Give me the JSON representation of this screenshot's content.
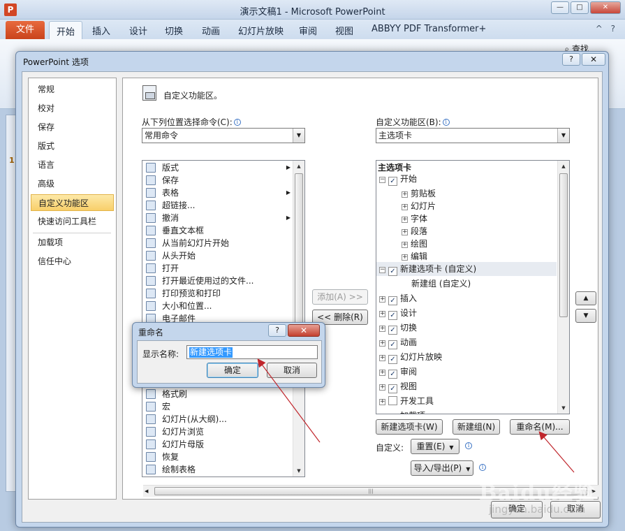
{
  "app": {
    "icon_letter": "P",
    "title": "演示文稿1 - Microsoft PowerPoint",
    "file_tab": "文件",
    "tabs": [
      "开始",
      "插入",
      "设计",
      "切换",
      "动画",
      "幻灯片放映",
      "审阅",
      "视图",
      "ABBYY PDF Transformer+"
    ],
    "find_label": "查找",
    "slide_number": "1"
  },
  "options_dialog": {
    "title": "PowerPoint 选项",
    "help": "?",
    "close": "✕",
    "nav": [
      "常规",
      "校对",
      "保存",
      "版式",
      "语言",
      "高级",
      "自定义功能区",
      "快速访问工具栏",
      "加载项",
      "信任中心"
    ],
    "active_nav": "自定义功能区",
    "header": "自定义功能区。",
    "choose_from_label": "从下列位置选择命令(C):",
    "choose_from_value": "常用命令",
    "customize_label": "自定义功能区(B):",
    "customize_value": "主选项卡",
    "commands": [
      {
        "label": "版式",
        "submenu": true
      },
      {
        "label": "保存",
        "submenu": false
      },
      {
        "label": "表格",
        "submenu": true
      },
      {
        "label": "超链接...",
        "submenu": false
      },
      {
        "label": "撤消",
        "submenu": true
      },
      {
        "label": "垂直文本框",
        "submenu": false
      },
      {
        "label": "从当前幻灯片开始",
        "submenu": false
      },
      {
        "label": "从头开始",
        "submenu": false
      },
      {
        "label": "打开",
        "submenu": false
      },
      {
        "label": "打开最近使用过的文件...",
        "submenu": false
      },
      {
        "label": "打印预览和打印",
        "submenu": false
      },
      {
        "label": "大小和位置...",
        "submenu": false
      },
      {
        "label": "电子邮件",
        "submenu": false
      }
    ],
    "commands_lower": [
      "格式刷",
      "宏",
      "幻灯片(从大纲)...",
      "幻灯片浏览",
      "幻灯片母版",
      "恢复",
      "绘制表格"
    ],
    "add_button": "添加(A) >>",
    "remove_button": "<< 删除(R)",
    "tree_header": "主选项卡",
    "tree": [
      {
        "label": "开始",
        "level": 0,
        "checkbox": true,
        "checked": true,
        "expander": "⊟"
      },
      {
        "label": "剪贴板",
        "level": 1,
        "expander": "+"
      },
      {
        "label": "幻灯片",
        "level": 1,
        "expander": "+"
      },
      {
        "label": "字体",
        "level": 1,
        "expander": "+"
      },
      {
        "label": "段落",
        "level": 1,
        "expander": "+"
      },
      {
        "label": "绘图",
        "level": 1,
        "expander": "+"
      },
      {
        "label": "编辑",
        "level": 1,
        "expander": "+"
      },
      {
        "label": "新建选项卡 (自定义)",
        "level": 0,
        "checkbox": true,
        "checked": true,
        "expander": "⊟",
        "selected": true
      },
      {
        "label": "新建组 (自定义)",
        "level": 2
      },
      {
        "label": "插入",
        "level": 0,
        "checkbox": true,
        "checked": true,
        "expander": "+"
      },
      {
        "label": "设计",
        "level": 0,
        "checkbox": true,
        "checked": true,
        "expander": "+"
      },
      {
        "label": "切换",
        "level": 0,
        "checkbox": true,
        "checked": true,
        "expander": "+"
      },
      {
        "label": "动画",
        "level": 0,
        "checkbox": true,
        "checked": true,
        "expander": "+"
      },
      {
        "label": "幻灯片放映",
        "level": 0,
        "checkbox": true,
        "checked": true,
        "expander": "+"
      },
      {
        "label": "审阅",
        "level": 0,
        "checkbox": true,
        "checked": true,
        "expander": "+"
      },
      {
        "label": "视图",
        "level": 0,
        "checkbox": true,
        "checked": true,
        "expander": "+"
      },
      {
        "label": "开发工具",
        "level": 0,
        "checkbox": true,
        "checked": false,
        "expander": "+"
      },
      {
        "label": "加载项",
        "level": 0,
        "checkbox": true,
        "checked": true,
        "expander": "+"
      }
    ],
    "move_up": "▲",
    "move_down": "▼",
    "new_tab_button": "新建选项卡(W)",
    "new_group_button": "新建组(N)",
    "rename_button": "重命名(M)...",
    "customize_label2": "自定义:",
    "reset_button": "重置(E)",
    "import_export_button": "导入/导出(P)",
    "ok": "确定",
    "cancel": "取消"
  },
  "rename_dialog": {
    "title": "重命名",
    "help": "?",
    "close": "✕",
    "display_name_label": "显示名称:",
    "display_name_value": "新建选项卡",
    "ok": "确定",
    "cancel": "取消"
  },
  "watermark": {
    "text": "Baidu经验",
    "url": "jingyan.baidu.com"
  },
  "colors": {
    "annotation_arrow": "#c0262c",
    "nav_active": "#f8cf6a",
    "file_tab": "#d24726",
    "selection": "#3399ff"
  }
}
